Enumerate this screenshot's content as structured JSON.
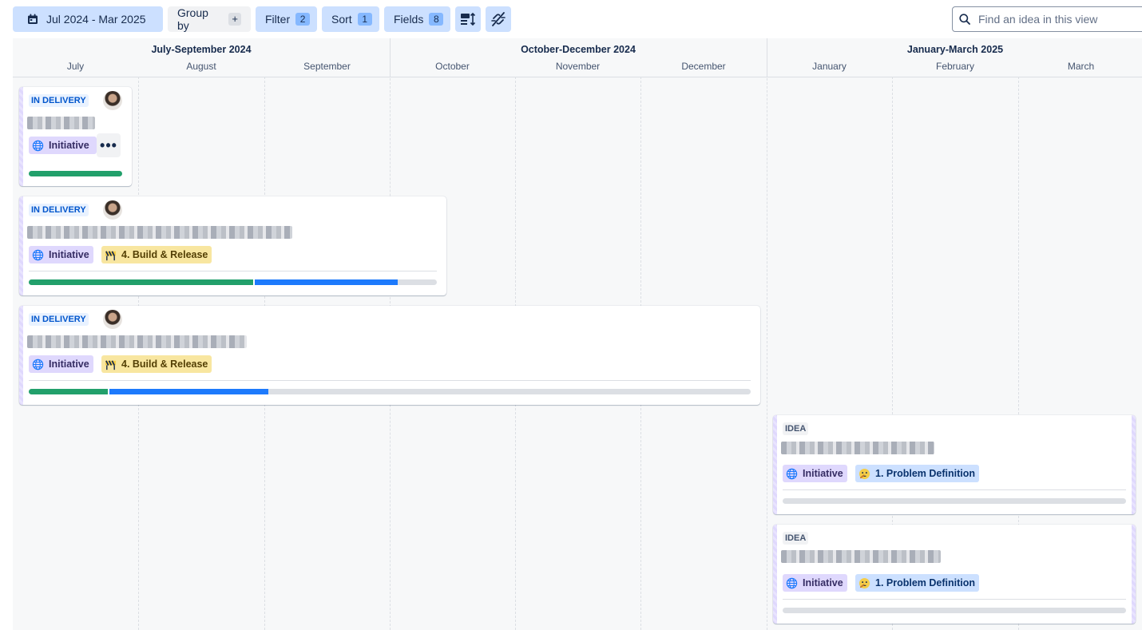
{
  "toolbar": {
    "date_range_label": "Jul 2024 - Mar 2025",
    "group_by_label": "Group by",
    "group_by_add": "+",
    "filter_label": "Filter",
    "filter_count": "2",
    "sort_label": "Sort",
    "sort_count": "1",
    "fields_label": "Fields",
    "fields_count": "8",
    "icons": [
      "calendar-icon",
      "row-height-icon",
      "unlink-icon",
      "search-icon"
    ]
  },
  "search": {
    "placeholder": "Find an idea in this view"
  },
  "timeline": {
    "quarters": [
      "July-September 2024",
      "October-December 2024",
      "January-March 2025"
    ],
    "months": [
      "July",
      "August",
      "September",
      "October",
      "November",
      "December",
      "January",
      "February",
      "March"
    ]
  },
  "cards": [
    {
      "status": "IN DELIVERY",
      "tags": [
        "Initiative"
      ],
      "progress": {
        "done": 1.0,
        "in_progress": 0.0
      }
    },
    {
      "status": "IN DELIVERY",
      "tags": [
        "Initiative",
        "4. Build & Release"
      ],
      "progress": {
        "done": 0.55,
        "in_progress": 0.35
      }
    },
    {
      "status": "IN DELIVERY",
      "tags": [
        "Initiative",
        "4. Build & Release"
      ],
      "progress": {
        "done": 0.11,
        "in_progress": 0.22
      }
    },
    {
      "status": "IDEA",
      "tags": [
        "Initiative",
        "1. Problem Definition"
      ],
      "progress": {
        "done": 0.0,
        "in_progress": 0.0
      }
    },
    {
      "status": "IDEA",
      "tags": [
        "Initiative",
        "1. Problem Definition"
      ],
      "progress": {
        "done": 0.0,
        "in_progress": 0.0
      }
    }
  ],
  "colors": {
    "toolbar_active": "#cce0ff",
    "progress_done": "#22a06b",
    "progress_in_progress": "#1d7afc",
    "initiative_tag": "#dfd8fd",
    "build_tag": "#f8e6a0",
    "problem_tag": "#cce0ff"
  }
}
